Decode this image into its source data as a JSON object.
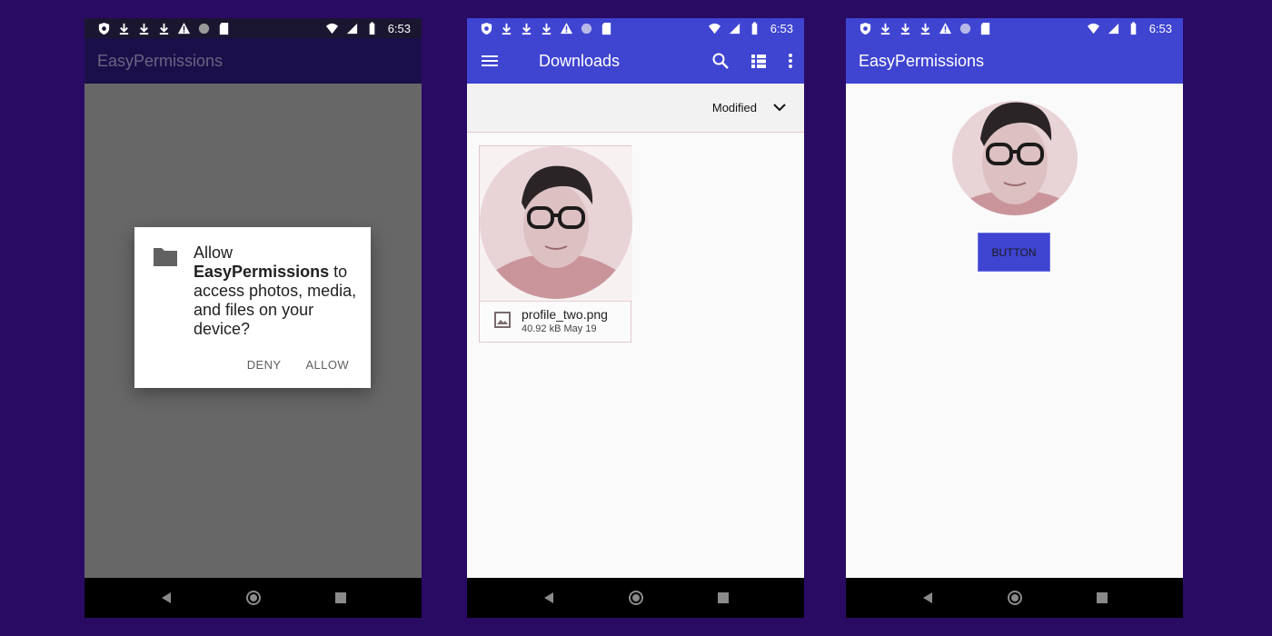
{
  "status_bar": {
    "time": "6:53"
  },
  "phone1": {
    "app_title": "EasyPermissions",
    "dialog": {
      "line_allow": "Allow",
      "app_name": "EasyPermissions",
      "word_to": "to",
      "line_rest": "access photos, media, and files on your device?",
      "deny": "DENY",
      "allow": "ALLOW"
    }
  },
  "phone2": {
    "title": "Downloads",
    "sort_label": "Modified",
    "file": {
      "name": "profile_two.png",
      "size": "40.92 kB",
      "date": "May 19"
    }
  },
  "phone3": {
    "app_title": "EasyPermissions",
    "button_label": "BUTTON"
  },
  "icons": {
    "status": [
      "shield-icon",
      "download-icon",
      "download-icon",
      "download-icon",
      "warning-icon",
      "circle-icon",
      "sd-card-icon",
      "wifi-icon",
      "signal-icon",
      "battery-icon"
    ],
    "nav": [
      "back-icon",
      "home-icon",
      "recents-icon"
    ]
  },
  "colors": {
    "background": "#2a0b64",
    "primary": "#3f44d1",
    "dim_overlay": "#676767",
    "navbar": "#000000"
  }
}
